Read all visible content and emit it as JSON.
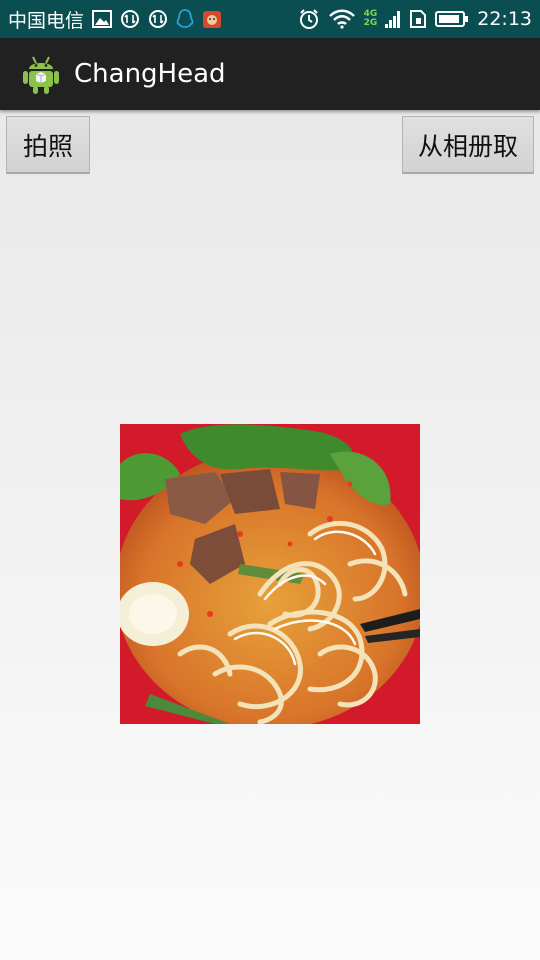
{
  "status_bar": {
    "carrier": "中国电信",
    "network_badge_top": "4G",
    "network_badge_bottom": "2G",
    "time": "22:13",
    "icons": [
      "gallery-icon",
      "data-sync-icon",
      "data-sync-icon",
      "qq-icon",
      "app-notification-icon",
      "alarm-icon",
      "wifi-icon",
      "signal-icon",
      "sim-icon",
      "battery-icon"
    ]
  },
  "action_bar": {
    "title": "ChangHead",
    "icon": "android-icon"
  },
  "buttons": {
    "camera_label": "拍照",
    "album_label": "从相册取"
  },
  "image": {
    "subject": "noodle-bowl-photo"
  },
  "colors": {
    "status_bar_bg": "#0b4e51",
    "action_bar_bg": "#212121",
    "bowl_red": "#c8102e",
    "network_green": "#7fd34f"
  }
}
